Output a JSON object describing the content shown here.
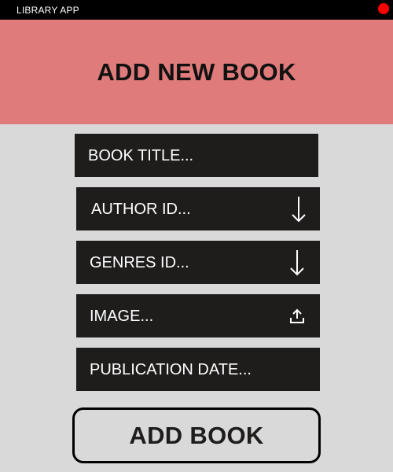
{
  "window": {
    "title": "LIBRARY APP",
    "close_color": "#ff0000"
  },
  "header": {
    "title": "ADD NEW BOOK",
    "background": "#e07b7b"
  },
  "form": {
    "fields": {
      "title": {
        "placeholder": "BOOK TITLE...",
        "value": ""
      },
      "author": {
        "placeholder": "AUTHOR ID...",
        "value": "",
        "icon": "arrow-down-icon"
      },
      "genres": {
        "placeholder": "GENRES ID...",
        "value": "",
        "icon": "arrow-down-icon"
      },
      "image": {
        "placeholder": "IMAGE...",
        "value": "",
        "icon": "upload-icon"
      },
      "publication_date": {
        "placeholder": "PUBLICATION DATE...",
        "value": ""
      }
    },
    "submit_label": "ADD BOOK"
  },
  "colors": {
    "field_background": "#1f1c1c",
    "page_background": "#d9d9d9"
  }
}
